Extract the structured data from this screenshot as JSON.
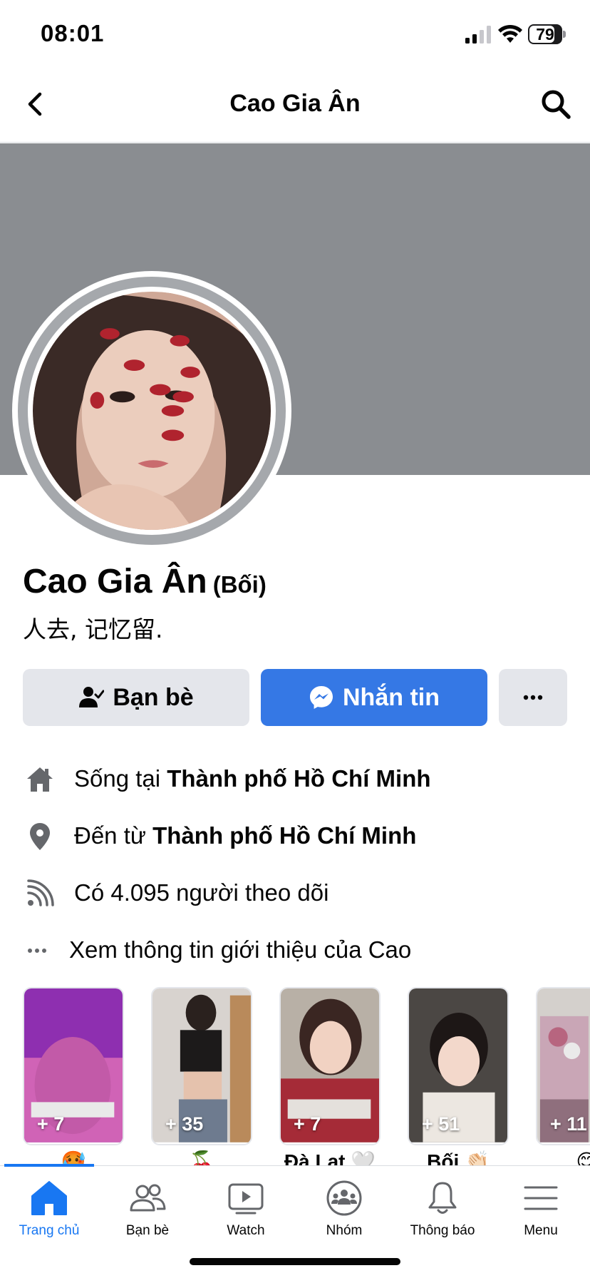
{
  "status_bar": {
    "time": "08:01",
    "battery": "79",
    "battery_level": 0.79
  },
  "header": {
    "title": "Cao Gia Ân",
    "back_icon": "chevron-left-icon",
    "search_icon": "search-icon"
  },
  "profile": {
    "name": "Cao Gia Ân",
    "alt_name": "(Bối)",
    "bio": "人去, 记忆留."
  },
  "actions": {
    "friends_label": "Bạn bè",
    "message_label": "Nhắn tin",
    "more_label": "•••"
  },
  "details": [
    {
      "icon": "home-icon",
      "prefix": "Sống tại ",
      "value": "Thành phố Hồ Chí Minh"
    },
    {
      "icon": "location-pin-icon",
      "prefix": "Đến từ ",
      "value": "Thành phố Hồ Chí Minh"
    },
    {
      "icon": "followers-rss-icon",
      "prefix": "Có 4.095 người theo dõi",
      "value": ""
    },
    {
      "icon": "more-dots-icon",
      "prefix": "Xem thông tin giới thiệu của Cao",
      "value": ""
    }
  ],
  "highlights": [
    {
      "count": "+ 7",
      "label": "🥵"
    },
    {
      "count": "+ 35",
      "label": "🍒"
    },
    {
      "count": "+ 7",
      "label": "Đà Lạt 🤍"
    },
    {
      "count": "+ 51",
      "label": "Bối 👏🏻"
    },
    {
      "count": "+ 11",
      "label": "😊"
    }
  ],
  "tabs": [
    {
      "label": "Trang chủ",
      "icon": "home-icon",
      "active": true
    },
    {
      "label": "Bạn bè",
      "icon": "friends-icon",
      "active": false
    },
    {
      "label": "Watch",
      "icon": "watch-play-icon",
      "active": false
    },
    {
      "label": "Nhóm",
      "icon": "groups-icon",
      "active": false
    },
    {
      "label": "Thông báo",
      "icon": "bell-icon",
      "active": false
    },
    {
      "label": "Menu",
      "icon": "menu-hamburger-icon",
      "active": false
    }
  ],
  "colors": {
    "accent": "#1877f2",
    "message_button": "#3578e5",
    "secondary_button": "#e4e6eb",
    "cover": "#8a8d91"
  }
}
